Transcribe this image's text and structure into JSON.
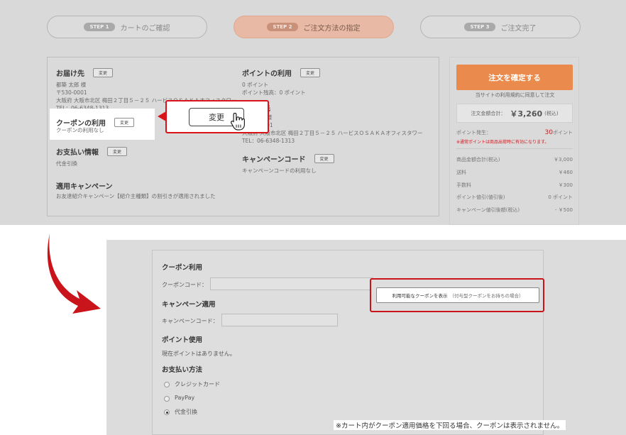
{
  "steps": [
    {
      "badge": "STEP 1",
      "label": "カートのご確認",
      "active": false
    },
    {
      "badge": "STEP 2",
      "label": "ご注文方法の指定",
      "active": true
    },
    {
      "badge": "STEP 3",
      "label": "ご注文完了",
      "active": false
    }
  ],
  "delivery": {
    "title": "お届け先",
    "change": "変更",
    "name": "都築 太郎 様",
    "zip": "〒530-0001",
    "address": "大阪府 大阪市北区 梅田２丁目５－２５ ハービスＯＳＡＫＡオフィスタワー",
    "tel": "TEL：06-6348-1313"
  },
  "coupon": {
    "title": "クーポンの利用",
    "change": "変更",
    "value": "クーポンの利用なし"
  },
  "payment": {
    "title": "お支払い情報",
    "change": "変更",
    "value": "代金引換"
  },
  "campaign_applied": {
    "title": "適用キャンペーン",
    "value": "お友達紹介キャンペーン【紹介主種類】の割引きが適用されました"
  },
  "points": {
    "title": "ポイントの利用",
    "change": "変更",
    "use": "0 ポイント",
    "balance": "ポイント残高：0 ポイント"
  },
  "billing": {
    "title": "ご請求先",
    "name": "都築 太郎 様",
    "zip": "〒530-0001",
    "address": "大阪府 大阪市北区 梅田２丁目５－２５ ハービスＯＳＡＫＡオフィスタワー",
    "tel": "TEL：06-6348-1313"
  },
  "campaign_code": {
    "title": "キャンペーンコード",
    "change": "変更",
    "value": "キャンペーンコードの利用なし"
  },
  "callout": {
    "button": "変更"
  },
  "summary": {
    "confirm": "注文を確定する",
    "agree": "当サイトの利用規約に同意して注文",
    "total_label": "注文金額合計：",
    "total_amount": "￥3,260",
    "total_tax": "(税込)",
    "points_label": "ポイント発生：",
    "points_value": "30",
    "points_unit": "ポイント",
    "points_note": "※通常ポイントは商品出荷時に有効になります。",
    "rows": [
      {
        "label": "商品金額合計(税込)",
        "value": "￥3,000"
      },
      {
        "label": "送料",
        "value": "￥460"
      },
      {
        "label": "手数料",
        "value": "￥300"
      },
      {
        "label": "ポイント値引(値引後)",
        "value": "0 ポイント"
      },
      {
        "label": "キャンペーン値引後額(税込)",
        "value": "- ￥500"
      }
    ]
  },
  "form": {
    "coupon_title": "クーポン利用",
    "coupon_label": "クーポンコード：",
    "coupon_button": "利用可能なクーポンを表示",
    "coupon_button_sub": "（付与型クーポンをお持ちの場合）",
    "campaign_title": "キャンペーン適用",
    "campaign_label": "キャンペーンコード：",
    "point_title": "ポイント使用",
    "point_text": "現在ポイントはありません。",
    "pay_title": "お支払い方法",
    "pay_options": [
      "クレジットカード",
      "PayPay",
      "代金引換"
    ]
  },
  "note": "※カート内がクーポン適用価格を下回る場合、クーポンは表示されません。",
  "colors": {
    "accent": "#ea8a4c",
    "highlight": "#d8141a",
    "active_step": "#e8b9a4"
  }
}
